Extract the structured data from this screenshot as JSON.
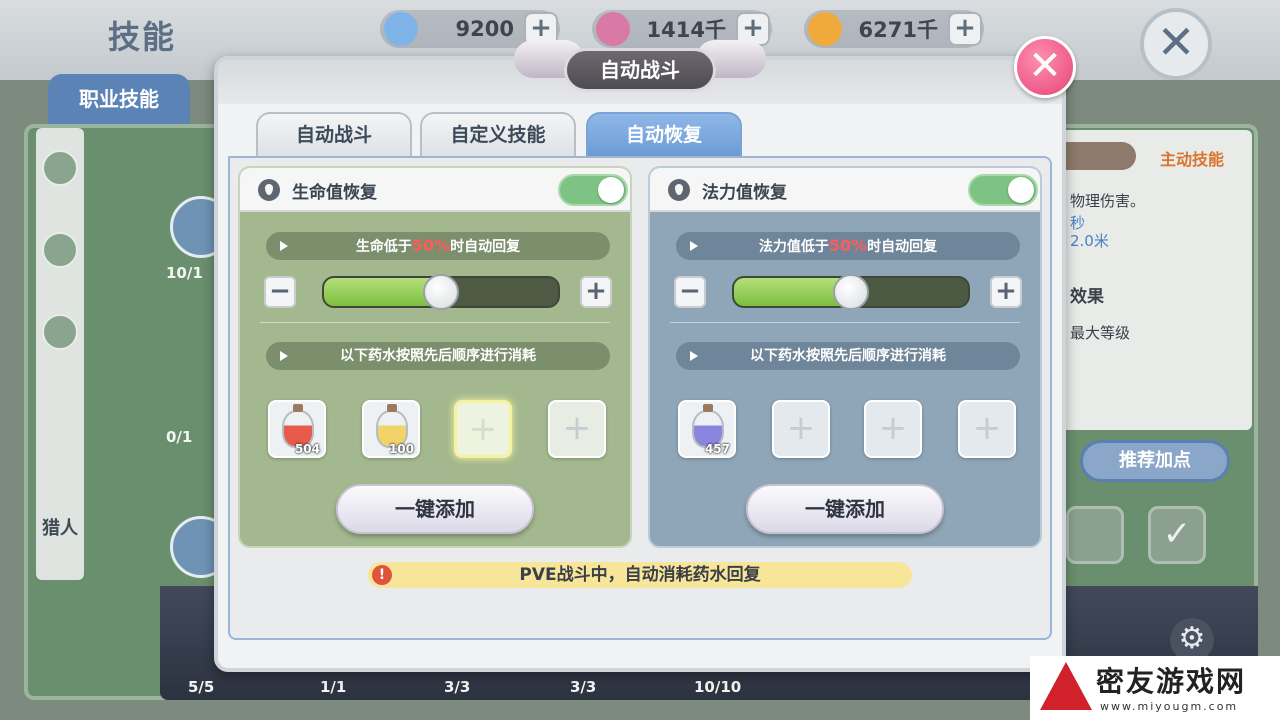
{
  "background": {
    "title": "技能",
    "currencies": [
      {
        "icon": "diamond-icon",
        "value": "9200",
        "color": "#7fb4e8"
      },
      {
        "icon": "crystal-icon",
        "value": "1414千",
        "color": "#d97aa6"
      },
      {
        "icon": "coin-icon",
        "value": "6271千",
        "color": "#f0a93b"
      }
    ],
    "tab_label": "职业技能",
    "side_label": "猎人",
    "right_panel": {
      "title": "主动技能",
      "lines": [
        "物理伤害。",
        "秒",
        "2.0米",
        "效果",
        "最大等级"
      ],
      "button": "推荐加点"
    },
    "counters": [
      "10/1",
      "0/1",
      "5/5",
      "1/1",
      "3/3",
      "3/3",
      "10/10"
    ]
  },
  "dialog": {
    "title": "自动战斗",
    "tabs": [
      {
        "label": "自动战斗",
        "active": false
      },
      {
        "label": "自定义技能",
        "active": false
      },
      {
        "label": "自动恢复",
        "active": true
      }
    ],
    "hp": {
      "title": "生命值恢复",
      "toggle_on": true,
      "threshold_prefix": "生命低于",
      "threshold_value": "50%",
      "threshold_suffix": "时自动回复",
      "slider_fraction": 0.5,
      "order_label": "以下药水按照先后顺序进行消耗",
      "potions": [
        {
          "count": "504",
          "color": "#e85a4a"
        },
        {
          "count": "100",
          "color": "#f2d36a"
        }
      ],
      "add_button": "一键添加"
    },
    "mp": {
      "title": "法力值恢复",
      "toggle_on": true,
      "threshold_prefix": "法力值低于",
      "threshold_value": "50%",
      "threshold_suffix": "时自动回复",
      "slider_fraction": 0.5,
      "order_label": "以下药水按照先后顺序进行消耗",
      "potions": [
        {
          "count": "457",
          "color": "#8a86e0"
        }
      ],
      "add_button": "一键添加"
    },
    "notice": "PVE战斗中，自动消耗药水回复",
    "minus_symbol": "−",
    "plus_symbol": "+",
    "close_symbol": "✕"
  },
  "watermark": {
    "name": "密友游戏网",
    "url": "www.miyougm.com"
  }
}
